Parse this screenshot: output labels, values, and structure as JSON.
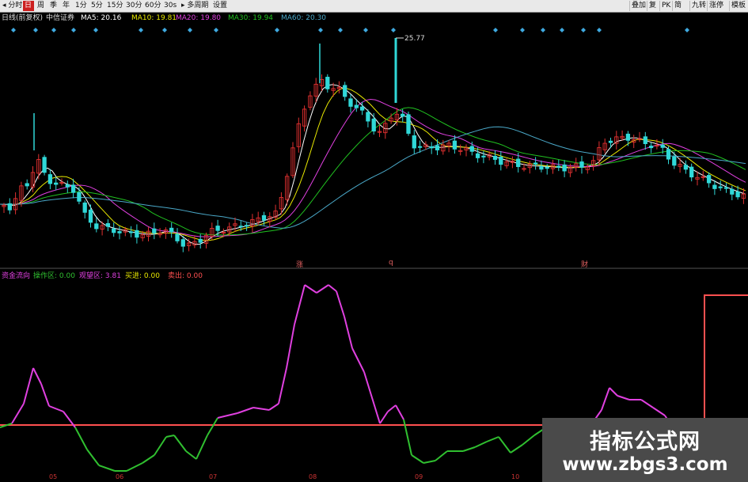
{
  "toolbar": {
    "left": [
      {
        "label": "◂ 分时",
        "active": false
      },
      {
        "label": "日",
        "active": true
      },
      {
        "label": "周",
        "active": false
      },
      {
        "label": "季",
        "active": false
      },
      {
        "label": "年",
        "active": false
      },
      {
        "label": "1分",
        "active": false
      },
      {
        "label": "5分",
        "active": false
      },
      {
        "label": "15分",
        "active": false
      },
      {
        "label": "30分",
        "active": false
      },
      {
        "label": "60分",
        "active": false
      },
      {
        "label": "30s",
        "active": false
      },
      {
        "label": "▸ 多周期",
        "active": false
      },
      {
        "label": "设置",
        "active": false
      }
    ],
    "right": [
      "叠加",
      "复",
      "PK",
      "简",
      "九转",
      "涨停",
      "模板"
    ]
  },
  "main_legend": {
    "period": "日线(前复权)",
    "name": "中信证券",
    "ma5": "MA5: 20.16",
    "ma10": "MA10: 19.81",
    "ma20": "MA20: 19.80",
    "ma30": "MA30: 19.94",
    "ma60": "MA60: 20.30"
  },
  "indicator_legend": {
    "name": "资金流向",
    "zone1": "操作区: 0.00",
    "zone2": "观望区: 3.81",
    "zone3": "买进: 0.00",
    "zone4": "卖出: 0.00"
  },
  "annotations": {
    "high_price": "25.77"
  },
  "events": [
    "涨",
    "q",
    "财"
  ],
  "x_ticks": [
    "05",
    "06",
    "07",
    "08",
    "09",
    "10"
  ],
  "colors": {
    "ma5": "#ffffff",
    "ma10": "#e8e800",
    "ma20": "#e040e0",
    "ma30": "#20c020",
    "ma60": "#4aa8c8",
    "up": "#e03030",
    "down": "#30d8d8",
    "indicator_above": "#e040e0",
    "indicator_below": "#30c030",
    "threshold": "#ff5050"
  },
  "watermark": {
    "line1": "指标公式网",
    "line2": "www.zbgs3.com"
  }
}
